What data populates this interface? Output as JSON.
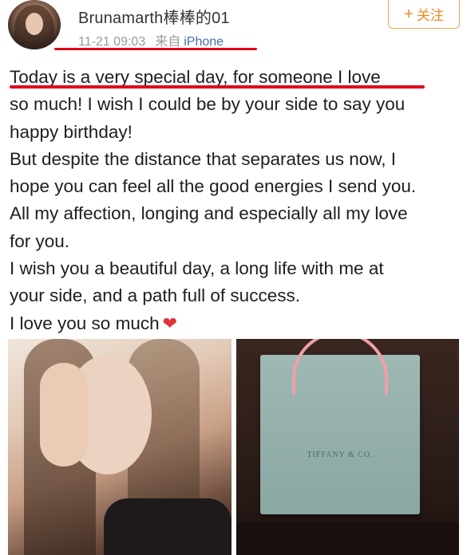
{
  "header": {
    "username": "Brunamarth棒棒的01",
    "timestamp": "11-21 09:03",
    "source_label": "来自",
    "source": "iPhone",
    "follow_label": "关注"
  },
  "post": {
    "lines": [
      "Today is a very special day, for someone I love",
      "so much! I wish I could be by your side to say you",
      "happy birthday!",
      "But despite the distance that separates us now, I",
      "hope you can feel all the good energies I send you.",
      "All my affection, longing and especially all my love",
      "for you.",
      "I wish you a beautiful day, a long life with me at",
      "your side, and a path full of success.",
      "I love you so much"
    ],
    "emoji": "heart-emoji"
  },
  "images": {
    "right_bag_brand": "TIFFANY & CO."
  },
  "colors": {
    "underline": "#e0001b",
    "follow": "#f08a1d",
    "link": "#4a6fa5"
  }
}
